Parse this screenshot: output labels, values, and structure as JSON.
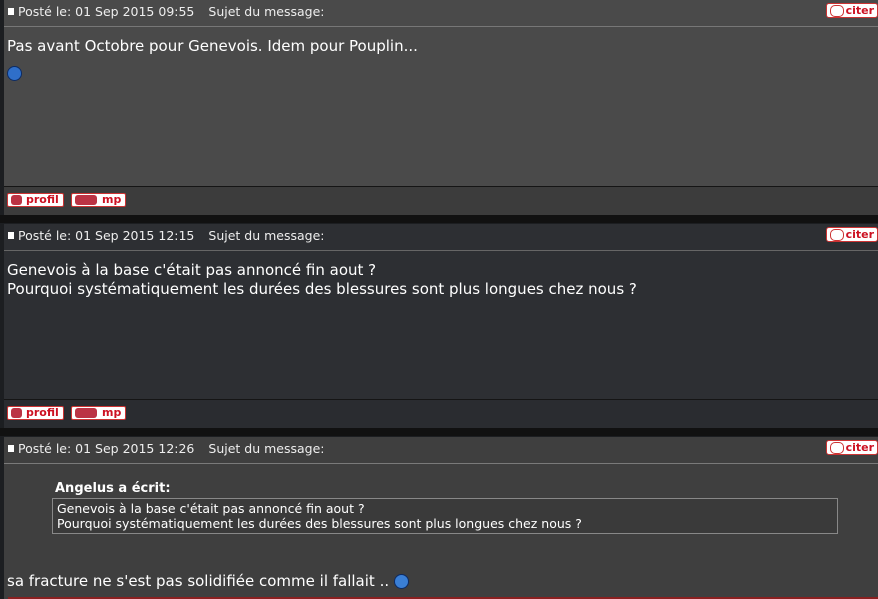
{
  "posts": [
    {
      "posted_label": "Posté le: 01 Sep 2015 09:55",
      "subject_label": "Sujet du message:",
      "quote_button": "citer",
      "body": "Pas avant Octobre pour Genevois. Idem pour Pouplin...",
      "smiley": "sad-smiley",
      "profile_button": "profil",
      "pm_button": "mp"
    },
    {
      "posted_label": "Posté le: 01 Sep 2015 12:15",
      "subject_label": "Sujet du message:",
      "quote_button": "citer",
      "body_line1": "Genevois à la base c'était pas annoncé fin aout ?",
      "body_line2": "Pourquoi systématiquement les durées des blessures sont plus longues chez nous ?",
      "profile_button": "profil",
      "pm_button": "mp"
    },
    {
      "posted_label": "Posté le: 01 Sep 2015 12:26",
      "subject_label": "Sujet du message:",
      "quote_button": "citer",
      "quote_author": "Angelus a écrit:",
      "quote_line1": "Genevois à la base c'était pas annoncé fin aout ?",
      "quote_line2": "Pourquoi systématiquement les durées des blessures sont plus longues chez nous ?",
      "body": "sa fracture ne s'est pas solidifiée comme il fallait ..",
      "smiley": "worried-smiley"
    }
  ]
}
